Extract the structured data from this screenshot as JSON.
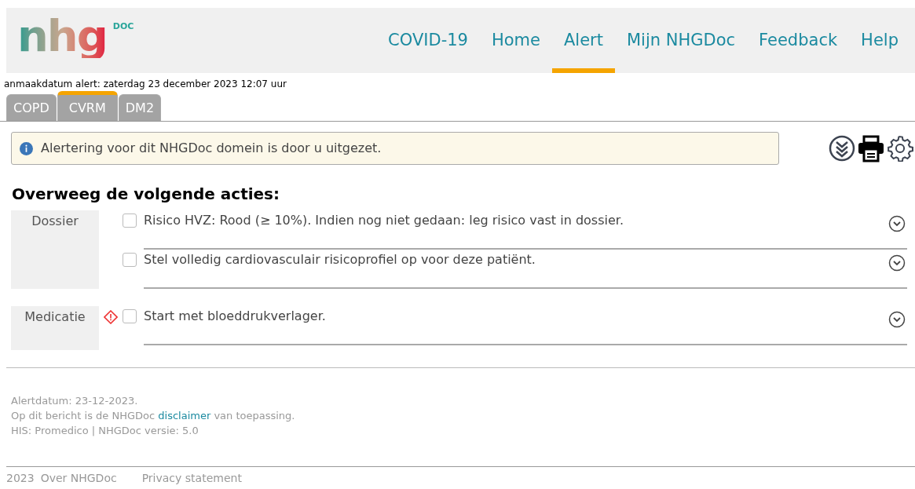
{
  "logo": {
    "word": "nhg",
    "sup": "DOC"
  },
  "nav": [
    {
      "label": "COVID-19",
      "selected": false
    },
    {
      "label": "Home",
      "selected": false
    },
    {
      "label": "Alert",
      "selected": true
    },
    {
      "label": "Mijn NHGDoc",
      "selected": false
    },
    {
      "label": "Feedback",
      "selected": false
    },
    {
      "label": "Help",
      "selected": false
    }
  ],
  "created": "anmaakdatum alert: zaterdag 23 december 2023 12:07 uur",
  "tabs": [
    {
      "label": "COPD",
      "selected": false
    },
    {
      "label": "CVRM",
      "selected": true
    },
    {
      "label": "DM2",
      "selected": false
    }
  ],
  "notice": "Alertering voor dit NHGDoc domein is door u uitgezet.",
  "heading": "Overweeg de volgende acties:",
  "groups": [
    {
      "label": "Dossier",
      "warning": false,
      "actions": [
        {
          "text": "Risico HVZ: Rood (≥ 10%). Indien nog niet gedaan: leg risico vast in dossier.",
          "checked": false
        },
        {
          "text": "Stel volledig cardiovasculair risicoprofiel op voor deze patiënt.",
          "checked": false
        }
      ]
    },
    {
      "label": "Medicatie",
      "warning": true,
      "actions": [
        {
          "text": "Start met bloeddrukverlager.",
          "checked": false
        }
      ]
    }
  ],
  "footer": {
    "alertdate": "Alertdatum: 23-12-2023.",
    "disclaimer_before": "Op dit bericht is de NHGDoc",
    "disclaimer_link": "disclaimer",
    "disclaimer_after": "van toepassing.",
    "his": "HIS: Promedico | NHGDoc versie: 5.0"
  },
  "bottom": {
    "copyright": "2023",
    "links": [
      "Over NHGDoc",
      "Privacy statement"
    ]
  }
}
